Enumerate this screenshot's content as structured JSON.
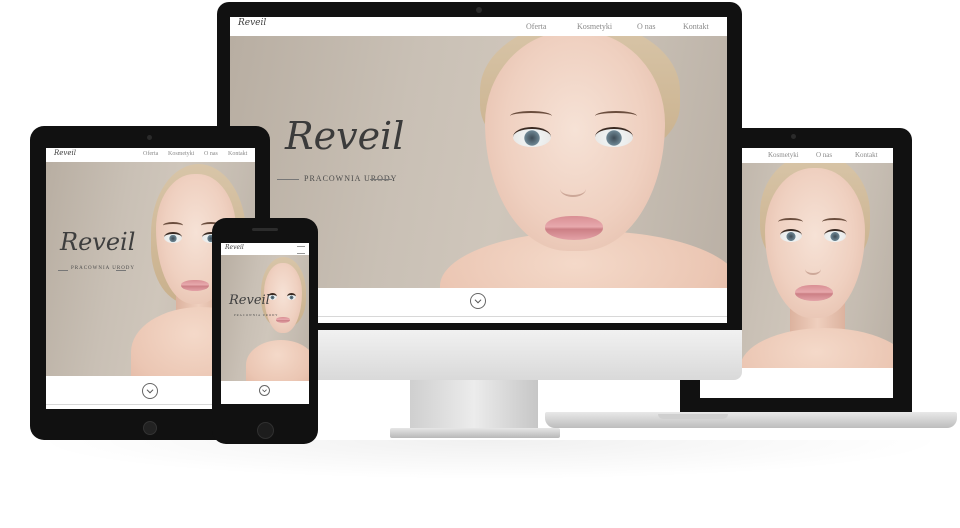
{
  "brand": {
    "name": "Reveil",
    "tagline": "PRACOWNIA URODY"
  },
  "nav": {
    "items": [
      "Oferta",
      "Kosmetyki",
      "O nas",
      "Kontakt"
    ]
  },
  "laptop_nav": {
    "items": [
      "Kosmetyki",
      "O nas",
      "Kontakt"
    ]
  },
  "colors": {
    "device_frame": "#111111",
    "hero_background": "#c9c0b5",
    "nav_text": "#8a8a8a"
  },
  "icons": {
    "scroll_down": "chevron-down-icon"
  }
}
